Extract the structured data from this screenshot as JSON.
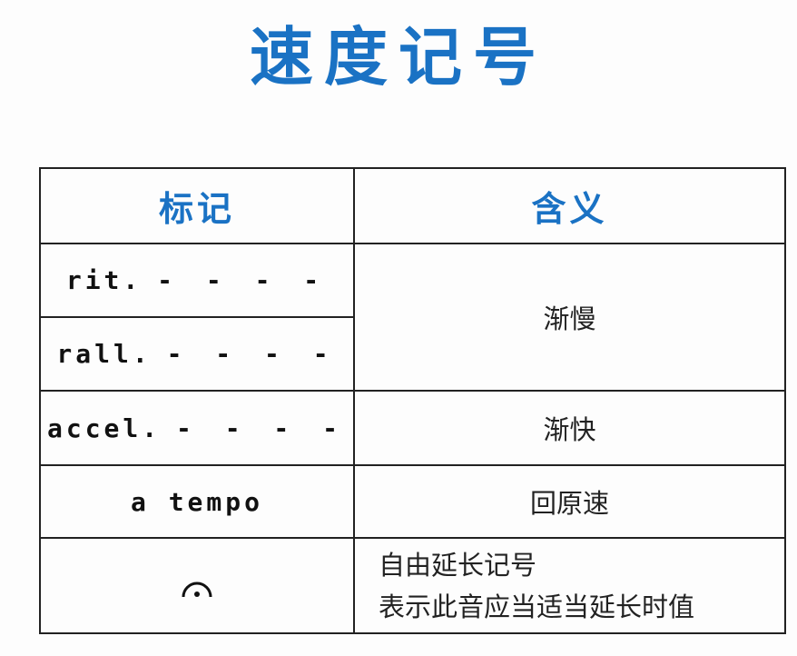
{
  "title": "速度记号",
  "table": {
    "headers": [
      "标记",
      "含义"
    ],
    "rows": [
      {
        "term": "rit.",
        "dashes": "- - - -",
        "meaning": "渐慢"
      },
      {
        "term": "rall.",
        "dashes": "- - - -"
      },
      {
        "term": "accel.",
        "dashes": "- - - -",
        "meaning": "渐快"
      },
      {
        "term": "a tempo",
        "meaning": "回原速"
      },
      {
        "symbol": "fermata-icon",
        "meaning_lines": [
          "自由延长记号",
          "表示此音应当适当延长时值"
        ]
      }
    ]
  },
  "colors": {
    "accent": "#1a72c4",
    "border": "#222222"
  }
}
